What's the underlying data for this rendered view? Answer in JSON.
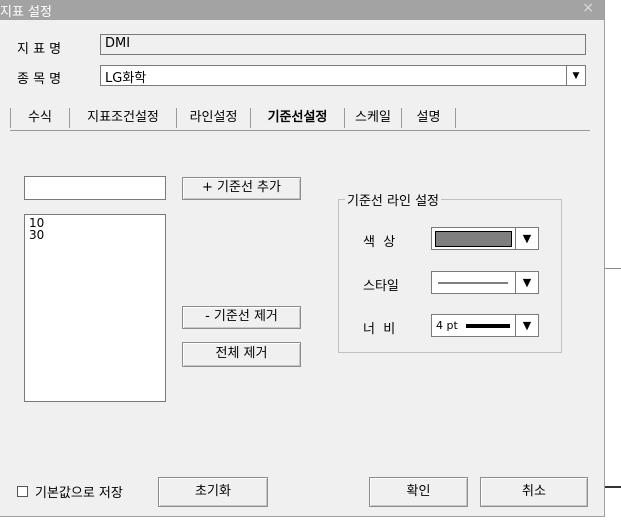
{
  "window": {
    "title": "지표 설정",
    "close_glyph": "×"
  },
  "form": {
    "indicator_label": "지 표 명",
    "indicator_value": "DMI",
    "stock_label": "종 목 명",
    "stock_value": "LG화학"
  },
  "tabs": [
    {
      "label": "수식"
    },
    {
      "label": "지표조건설정"
    },
    {
      "label": "라인설정"
    },
    {
      "label": "기준선설정",
      "active": true
    },
    {
      "label": "스케일"
    },
    {
      "label": "설명"
    }
  ],
  "baseline": {
    "new_value": "",
    "add_button": "+ 기준선 추가",
    "remove_button": "- 기준선 제거",
    "clear_button": "전체 제거",
    "values": [
      "10",
      "30"
    ]
  },
  "line_settings": {
    "group_title": "기준선 라인 설정",
    "color_label": "색  상",
    "color_value": "#7f7f7f",
    "style_label": "스타일",
    "width_label": "너  비",
    "width_value": "4 pt"
  },
  "footer": {
    "save_default_label": "기본값으로 저장",
    "save_default_checked": false,
    "reset_button": "초기화",
    "ok_button": "확인",
    "cancel_button": "취소"
  },
  "icons": {
    "dropdown": "▼",
    "checkbox": "☐"
  }
}
